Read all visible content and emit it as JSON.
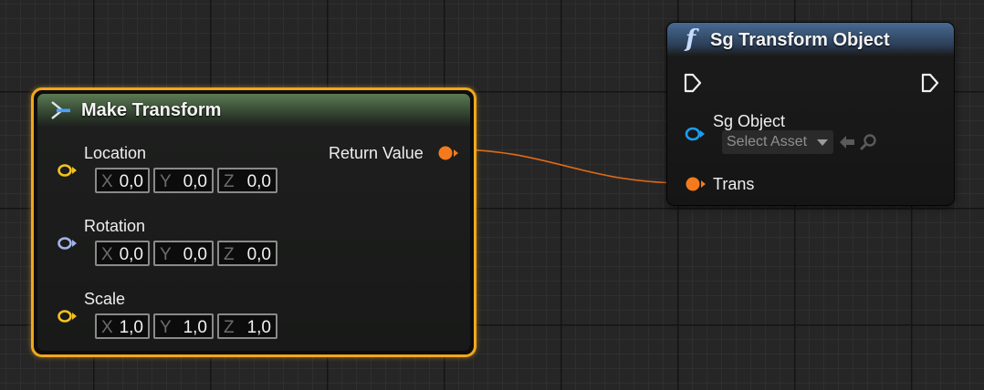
{
  "make_transform": {
    "title": "Make Transform",
    "inputs": [
      {
        "label": "Location",
        "x": "0,0",
        "y": "0,0",
        "z": "0,0"
      },
      {
        "label": "Rotation",
        "x": "0,0",
        "y": "0,0",
        "z": "0,0"
      },
      {
        "label": "Scale",
        "x": "1,0",
        "y": "1,0",
        "z": "1,0"
      }
    ],
    "axis_labels": {
      "x": "X",
      "y": "Y",
      "z": "Z"
    },
    "output": "Return Value"
  },
  "sg_transform_object": {
    "title": "Sg Transform Object",
    "object_pin": "Sg Object",
    "asset_picker": "Select Asset",
    "trans_pin": "Trans"
  },
  "colors": {
    "selection_outline": "#f0a71e",
    "struct_pin_vector": "#f3c21d",
    "struct_pin_rotator": "#a3b2e8",
    "struct_pin_transform": "#f57a1e",
    "object_pin": "#1a9ef0",
    "wire": "#e06a16",
    "exec_pin": "#f0f0f0"
  },
  "icons": {
    "make_transform": "make-struct-icon",
    "function": "function-icon",
    "browse": "arrow-left-icon",
    "search": "search-icon",
    "dropdown": "chevron-down-icon"
  }
}
